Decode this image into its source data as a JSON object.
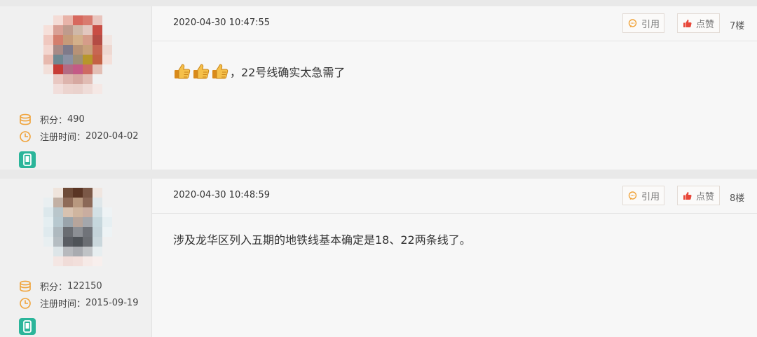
{
  "posts": [
    {
      "user": {
        "points_label": "积分：",
        "points": "490",
        "reg_label": "注册时间：",
        "reg_date": "2020-04-02"
      },
      "time": "2020-04-30 10:47:55",
      "quote_label": "引用",
      "like_label": "点赞",
      "floor": "7楼",
      "content": "，22号线确实太急需了",
      "emoji_count": 3
    },
    {
      "user": {
        "points_label": "积分：",
        "points": "122150",
        "reg_label": "注册时间：",
        "reg_date": "2015-09-19"
      },
      "time": "2020-04-30 10:48:59",
      "quote_label": "引用",
      "like_label": "点赞",
      "floor": "8楼",
      "content": "涉及龙华区列入五期的地铁线基本确定是18、22两条线了。"
    }
  ],
  "colors": {
    "accent_orange": "#f0a33a",
    "like_red": "#e8483a",
    "device_green": "#2bb59a"
  }
}
